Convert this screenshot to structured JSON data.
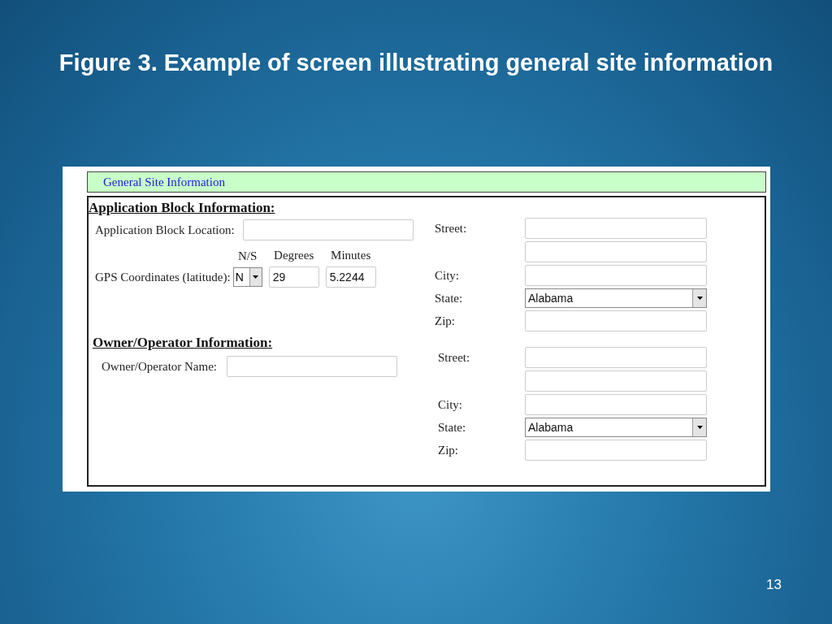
{
  "slide": {
    "title": "Figure 3. Example of screen illustrating general site information",
    "page_number": "13"
  },
  "form": {
    "header": "General Site Information",
    "sections": [
      {
        "heading": "Application Block Information:",
        "fields": [
          {
            "kind": "text",
            "label": "Application Block Location:"
          },
          {
            "kind": "gps",
            "label": "GPS Coordinates (latitude):",
            "columns": [
              "N/S",
              "Degrees",
              "Minutes"
            ],
            "hemisphere": "N",
            "degrees": "29",
            "minutes": "5.2244"
          }
        ],
        "address": [
          {
            "kind": "text",
            "label": "Street:"
          },
          {
            "kind": "blank"
          },
          {
            "kind": "text",
            "label": "City:"
          },
          {
            "kind": "select",
            "label": "State:",
            "value": "Alabama"
          },
          {
            "kind": "text",
            "label": "Zip:"
          }
        ]
      },
      {
        "heading": "Owner/Operator Information:",
        "fields": [
          {
            "kind": "text",
            "label": "Owner/Operator Name:"
          }
        ],
        "address": [
          {
            "kind": "text",
            "label": "Street:"
          },
          {
            "kind": "blank"
          },
          {
            "kind": "text",
            "label": "City:"
          },
          {
            "kind": "select",
            "label": "State:",
            "value": "Alabama"
          },
          {
            "kind": "text",
            "label": "Zip:"
          }
        ]
      }
    ]
  }
}
